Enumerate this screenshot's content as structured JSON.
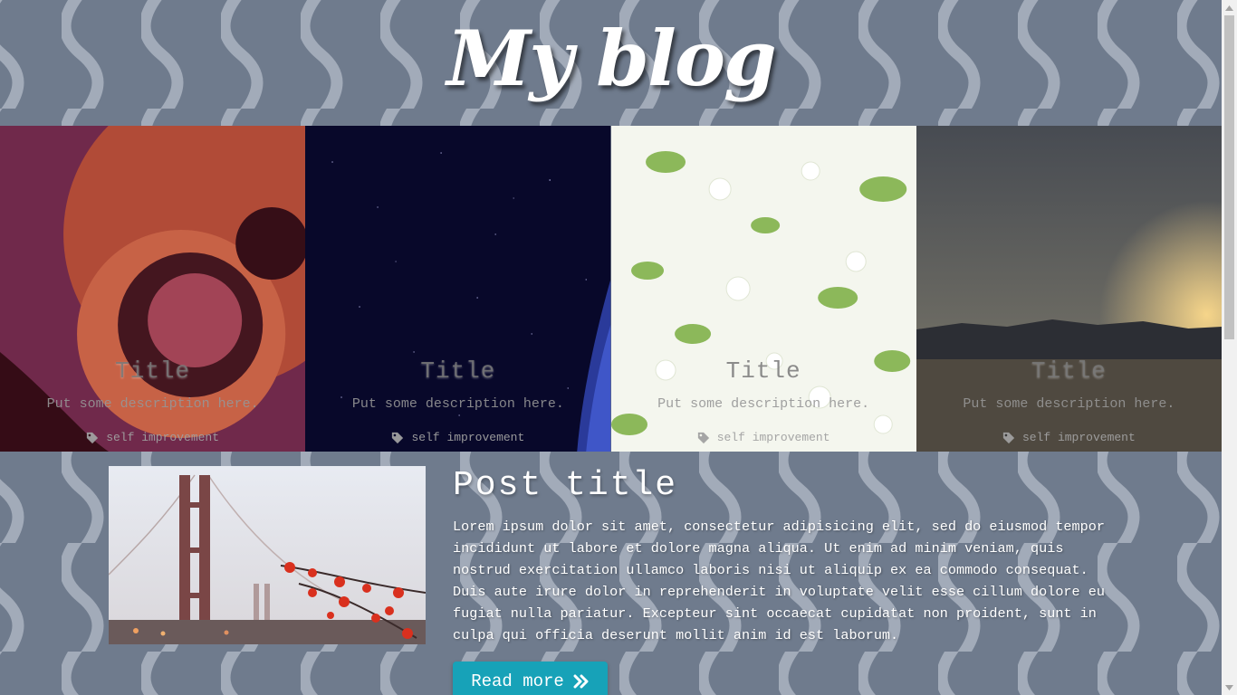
{
  "header": {
    "title": "My blog"
  },
  "featured": [
    {
      "title": "Title",
      "description": "Put some description here.",
      "tag": "self improvement",
      "image": "abstract-swirl"
    },
    {
      "title": "Title",
      "description": "Put some description here.",
      "tag": "self improvement",
      "image": "night-sky"
    },
    {
      "title": "Title",
      "description": "Put some description here.",
      "tag": "self improvement",
      "image": "white-blossoms"
    },
    {
      "title": "Title",
      "description": "Put some description here.",
      "tag": "self improvement",
      "image": "mountain-sunset"
    }
  ],
  "post": {
    "image": "golden-gate-bridge-flowers",
    "title": "Post title",
    "body": "Lorem ipsum dolor sit amet, consectetur adipisicing elit, sed do eiusmod tempor incididunt ut labore et dolore magna aliqua. Ut enim ad minim veniam, quis nostrud exercitation ullamco laboris nisi ut aliquip ex ea commodo consequat. Duis aute irure dolor in reprehenderit in voluptate velit esse cillum dolore eu fugiat nulla pariatur. Excepteur sint occaecat cupidatat non proident, sunt in culpa qui officia deserunt mollit anim id est laborum.",
    "read_more": "Read more",
    "read_more_icon": "double-chevron-right-icon"
  },
  "colors": {
    "background": "#6f7b8d",
    "pattern": "#a2abb9",
    "button": "#17a2b8"
  }
}
